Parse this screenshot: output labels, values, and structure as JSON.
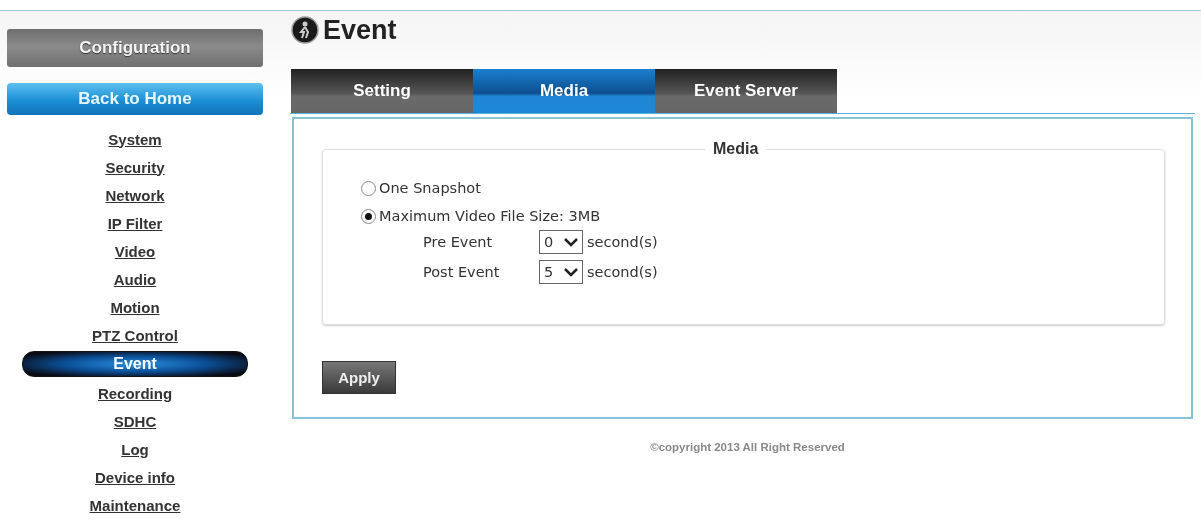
{
  "sidebar": {
    "header": "Configuration",
    "home_button": "Back to Home",
    "items": [
      {
        "label": "System",
        "selected": false
      },
      {
        "label": "Security",
        "selected": false
      },
      {
        "label": "Network",
        "selected": false
      },
      {
        "label": "IP Filter",
        "selected": false
      },
      {
        "label": "Video",
        "selected": false
      },
      {
        "label": "Audio",
        "selected": false
      },
      {
        "label": "Motion",
        "selected": false
      },
      {
        "label": "PTZ Control",
        "selected": false
      },
      {
        "label": "Event",
        "selected": true
      },
      {
        "label": "Recording",
        "selected": false
      },
      {
        "label": "SDHC",
        "selected": false
      },
      {
        "label": "Log",
        "selected": false
      },
      {
        "label": "Device info",
        "selected": false
      },
      {
        "label": "Maintenance",
        "selected": false
      }
    ]
  },
  "page": {
    "title": "Event"
  },
  "tabs": [
    {
      "label": "Setting",
      "selected": false
    },
    {
      "label": "Media",
      "selected": true
    },
    {
      "label": "Event Server",
      "selected": false
    }
  ],
  "media": {
    "legend": "Media",
    "options": [
      {
        "label": "One Snapshot",
        "selected": false
      },
      {
        "label": "Maximum Video File Size: 3MB",
        "selected": true
      }
    ],
    "timings": [
      {
        "label": "Pre Event",
        "value": "0",
        "unit": "second(s)"
      },
      {
        "label": "Post Event",
        "value": "5",
        "unit": "second(s)"
      }
    ]
  },
  "apply_button": "Apply",
  "footer": "©copyright 2013 All Right Reserved"
}
